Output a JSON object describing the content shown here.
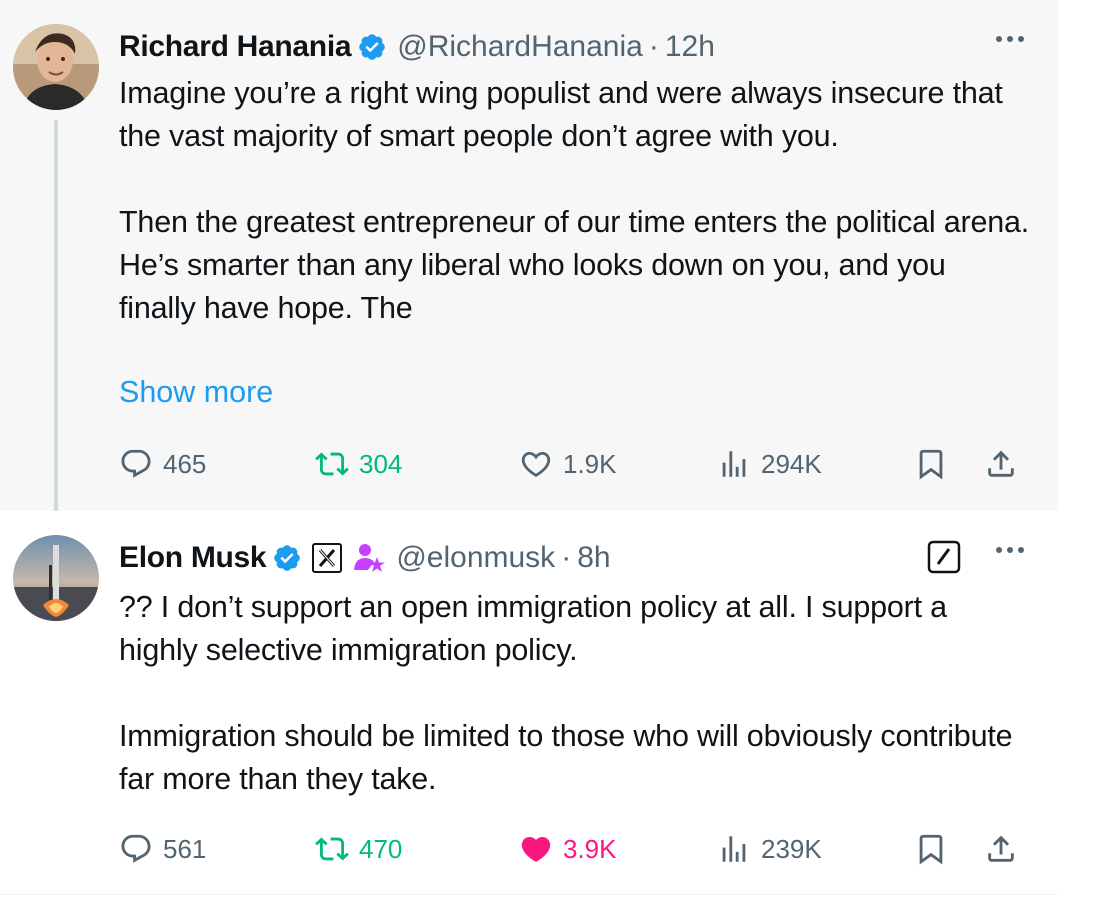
{
  "tweets": [
    {
      "author": "Richard Hanania",
      "handle": "@RichardHanania",
      "time": "12h",
      "paragraphs": [
        "Imagine you’re a right wing populist and were always insecure that the vast majority of smart people don’t agree with you.",
        "Then the greatest entrepreneur of our time enters the political arena. He’s smarter than any liberal who looks down on you, and you finally have hope. The"
      ],
      "show_more": "Show more",
      "replies": "465",
      "reposts": "304",
      "likes": "1.9K",
      "views": "294K"
    },
    {
      "author": "Elon Musk",
      "handle": "@elonmusk",
      "time": "8h",
      "paragraphs": [
        "?? I don’t support an open immigration policy at all. I support a highly selective immigration policy.",
        "Immigration should be limited to those who will obviously contribute far more than they take."
      ],
      "replies": "561",
      "reposts": "470",
      "likes": "3.9K",
      "views": "239K"
    }
  ],
  "separator": "·",
  "colors": {
    "verified": "#1d9bf0",
    "secondary_text": "#536471",
    "link": "#1d9bf0",
    "repost_green": "#00ba7c",
    "like_pink": "#f91880",
    "affiliate_badge": "#c540ff"
  },
  "icons": {
    "reply": "reply-icon",
    "repost": "repost-icon",
    "like": "heart-icon",
    "views": "views-chart-icon",
    "bookmark": "bookmark-icon",
    "share": "share-icon",
    "more": "more-dots-icon",
    "edit": "edit-icon"
  }
}
